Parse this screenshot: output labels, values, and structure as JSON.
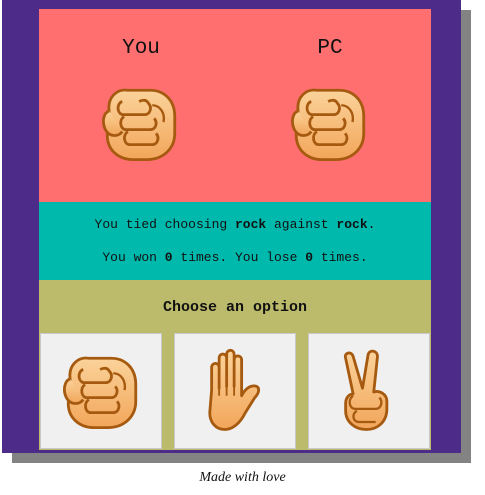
{
  "arena": {
    "player_label": "You",
    "computer_label": "PC",
    "player_hand_icon": "rock-fist-icon",
    "computer_hand_icon": "rock-fist-icon"
  },
  "result": {
    "prefix": "You tied choosing ",
    "player_choice": "rock",
    "middle": " against ",
    "computer_choice": "rock",
    "suffix": ".",
    "wins_prefix": "You won ",
    "wins": "0",
    "wins_middle": " times. You lose ",
    "losses": "0",
    "losses_suffix": " times."
  },
  "chooser": {
    "title": "Choose an option",
    "options": [
      {
        "id": "rock",
        "icon": "rock-fist-icon"
      },
      {
        "id": "paper",
        "icon": "paper-hand-icon"
      },
      {
        "id": "scissors",
        "icon": "scissors-peace-icon"
      }
    ]
  },
  "footer": {
    "text": "Made with love"
  },
  "colors": {
    "frame": "#4d2b88",
    "arena": "#ff6f6f",
    "status": "#00b9ad",
    "chooser": "#bcbb6c",
    "skin": "#f7b36a",
    "skin_outline": "#a65a10"
  }
}
